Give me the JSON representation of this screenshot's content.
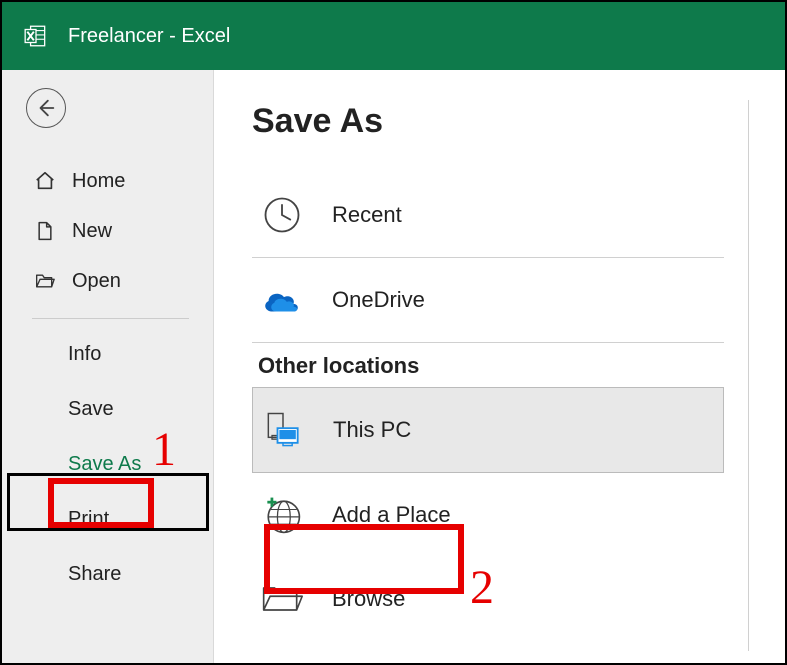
{
  "titlebar": {
    "title": "Freelancer  -  Excel"
  },
  "sidebar": {
    "nav": [
      {
        "label": "Home"
      },
      {
        "label": "New"
      },
      {
        "label": "Open"
      }
    ],
    "sub": [
      {
        "label": "Info"
      },
      {
        "label": "Save"
      },
      {
        "label": "Save As"
      },
      {
        "label": "Print"
      },
      {
        "label": "Share"
      }
    ]
  },
  "main": {
    "heading": "Save As",
    "section_other": "Other locations",
    "locations": {
      "recent": "Recent",
      "onedrive": "OneDrive",
      "thispc": "This PC",
      "addplace": "Add a Place",
      "browse": "Browse"
    }
  },
  "annotations": {
    "n1": "1",
    "n2": "2"
  }
}
